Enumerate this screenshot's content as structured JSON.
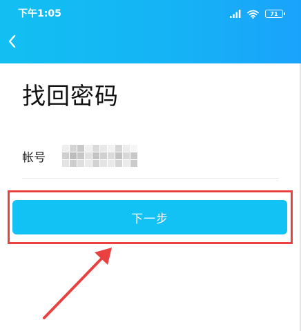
{
  "status_bar": {
    "time": "下午1:05",
    "battery_level": "71",
    "icons": [
      "signal-icon",
      "wifi-icon",
      "battery-icon"
    ]
  },
  "header": {
    "background_color": "#15b4f5",
    "back_icon": "chevron-left-icon"
  },
  "form": {
    "title": "找回密码",
    "account_label": "帐号",
    "account_value": "■■■■■■■■■■"
  },
  "next_button": {
    "label": "下一步",
    "color": "#12c2f5"
  },
  "annotation": {
    "highlight_color": "#e8413f",
    "arrow_icon": "arrow-icon"
  }
}
